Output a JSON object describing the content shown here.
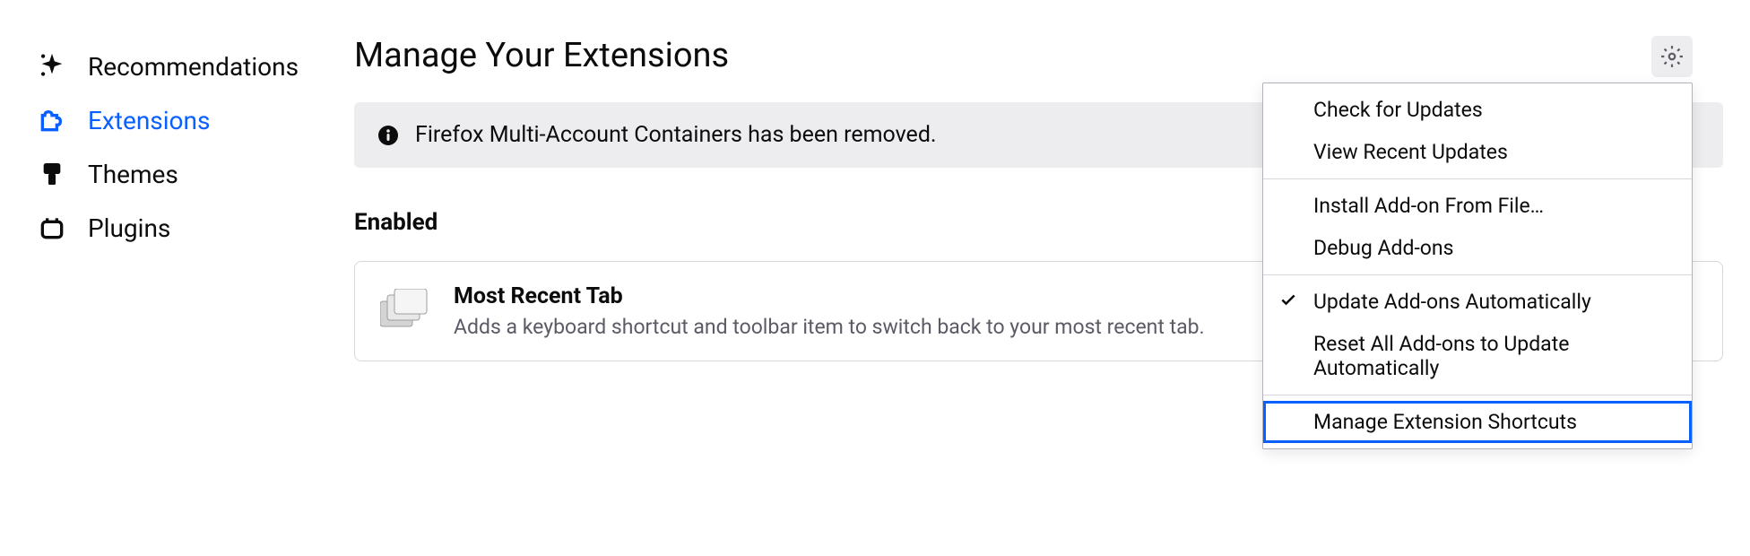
{
  "sidebar": {
    "items": [
      {
        "label": "Recommendations"
      },
      {
        "label": "Extensions"
      },
      {
        "label": "Themes"
      },
      {
        "label": "Plugins"
      }
    ]
  },
  "page": {
    "title": "Manage Your Extensions"
  },
  "notice": {
    "text": "Firefox Multi-Account Containers has been removed."
  },
  "section": {
    "enabled_label": "Enabled"
  },
  "extension": {
    "name": "Most Recent Tab",
    "description": "Adds a keyboard shortcut and toolbar item to switch back to your most recent tab."
  },
  "menu": {
    "check_updates": "Check for Updates",
    "view_recent_updates": "View Recent Updates",
    "install_from_file": "Install Add-on From File…",
    "debug_addons": "Debug Add-ons",
    "update_automatically": "Update Add-ons Automatically",
    "reset_update_auto": "Reset All Add-ons to Update Automatically",
    "manage_shortcuts": "Manage Extension Shortcuts"
  }
}
